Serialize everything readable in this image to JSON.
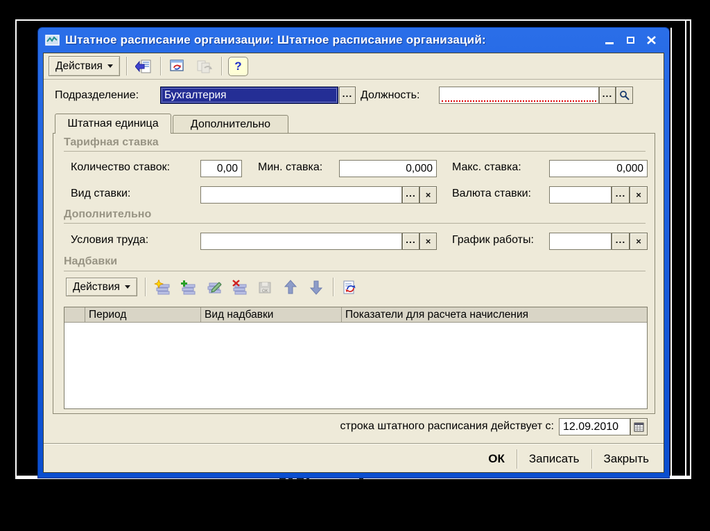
{
  "colors": {
    "titlebar_blue": "#0d53d3",
    "client_beige": "#eeead9",
    "selection_navy": "#242e95",
    "required_red": "#dc0000",
    "group_title_gray": "#989484"
  },
  "window": {
    "title": "Штатное расписание организации: Штатное расписание организаций:"
  },
  "toolbar": {
    "actions_label": "Действия",
    "help_glyph": "?"
  },
  "controls": {
    "ellipsis": "...",
    "clear": "×"
  },
  "fields": {
    "department_label": "Подразделение:",
    "department_value": "Бухгалтерия",
    "position_label": "Должность:",
    "position_value": ""
  },
  "tabs": {
    "active": "Штатная единица",
    "inactive": "Дополнительно"
  },
  "tariff": {
    "title": "Тарифная ставка",
    "qty_label": "Количество ставок:",
    "qty_value": "0,00",
    "min_label": "Мин. ставка:",
    "min_value": "0,000",
    "max_label": "Макс. ставка:",
    "max_value": "0,000",
    "kind_label": "Вид ставки:",
    "kind_value": "",
    "currency_label": "Валюта ставки:",
    "currency_value": ""
  },
  "additional": {
    "title": "Дополнительно",
    "conditions_label": "Условия труда:",
    "conditions_value": "",
    "schedule_label": "График работы:",
    "schedule_value": ""
  },
  "allowances": {
    "title": "Надбавки",
    "actions_label": "Действия",
    "columns": [
      "Период",
      "Вид надбавки",
      "Показатели для расчета начисления"
    ]
  },
  "footer": {
    "date_label": "строка штатного расписания действует с:",
    "date_value": "12.09.2010"
  },
  "buttons": {
    "ok": "ОК",
    "save": "Записать",
    "close": "Закрыть"
  }
}
